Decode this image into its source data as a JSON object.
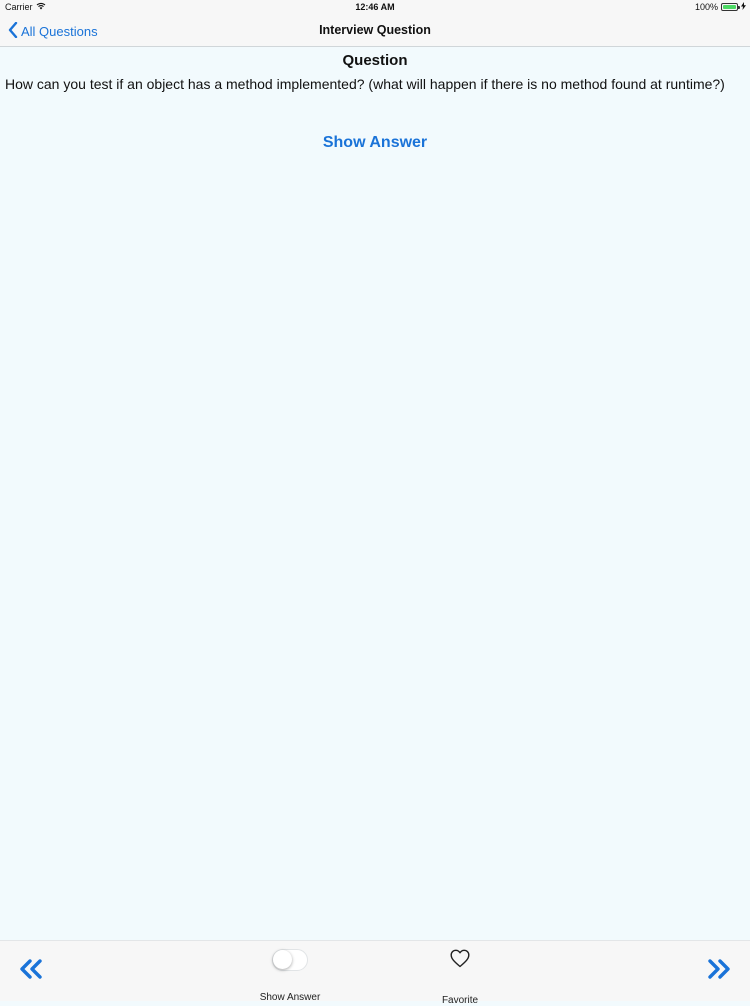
{
  "status_bar": {
    "carrier": "Carrier",
    "time": "12:46 AM",
    "battery": "100%",
    "battery_level": 1.0
  },
  "nav": {
    "back_label": "All Questions",
    "title": "Interview Question"
  },
  "content": {
    "heading": "Question",
    "question": "How can you test if an object has a method implemented? (what will happen if there is no method found at runtime?)",
    "show_answer_link": "Show Answer"
  },
  "toolbar": {
    "toggle_label": "Show Answer",
    "toggle_on": false,
    "favorite_label": "Favorite"
  },
  "icons": {
    "back": "chevron-left-icon",
    "prev": "double-chevron-left-icon",
    "next": "double-chevron-right-icon",
    "favorite": "heart-outline-icon",
    "wifi": "wifi-icon",
    "battery": "battery-icon",
    "charging": "charging-bolt-icon"
  },
  "colors": {
    "accent": "#1a73d8",
    "background": "#f2fafd",
    "bar_background": "#f7f7f7",
    "battery_fill": "#4cd964"
  }
}
